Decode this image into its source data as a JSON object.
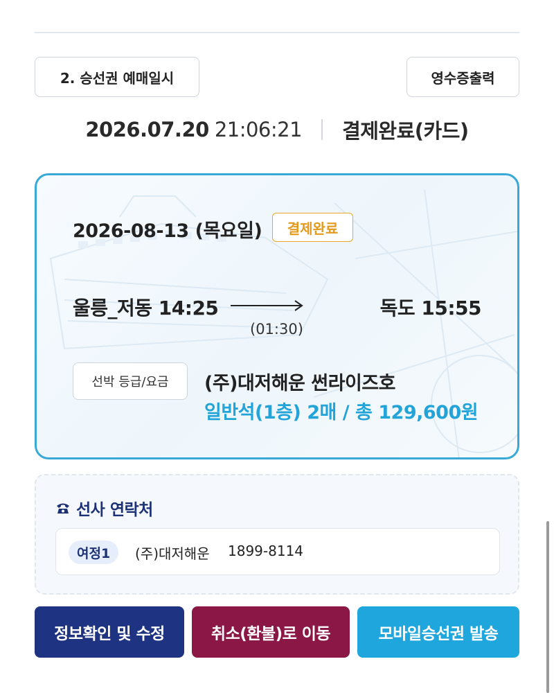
{
  "section": {
    "label": "2. 승선권 예매일시",
    "receipt_label": "영수증출력"
  },
  "purchase": {
    "date": "2026.07.20",
    "time": "21:06:21",
    "status": "결제완료(카드)"
  },
  "ticket": {
    "date": "2026-08-13 (목요일)",
    "status": "결제완료",
    "departure": "울릉_저동 14:25",
    "arrival": "독도 15:55",
    "duration": "(01:30)",
    "class_label": "선박 등급/요금",
    "vessel": "(주)대저해운 썬라이즈호",
    "fare": "일반석(1층) 2매 / 총 129,600원"
  },
  "contact": {
    "title": "선사 연락처",
    "leg": "여정1",
    "company": "(주)대저해운",
    "phone": "1899-8114"
  },
  "actions": {
    "edit": "정보확인 및 수정",
    "cancel": "취소(환불)로 이동",
    "mobile": "모바일승선권 발송"
  },
  "colors": {
    "accent": "#38a9d6",
    "fare": "#22a4d8",
    "badge": "#e39a1c",
    "navy": "#1f3383",
    "burgundy": "#8a1746",
    "sky": "#1fa6dc"
  },
  "icons": {
    "contact": "phone-icon",
    "route": "arrow-right-icon"
  }
}
